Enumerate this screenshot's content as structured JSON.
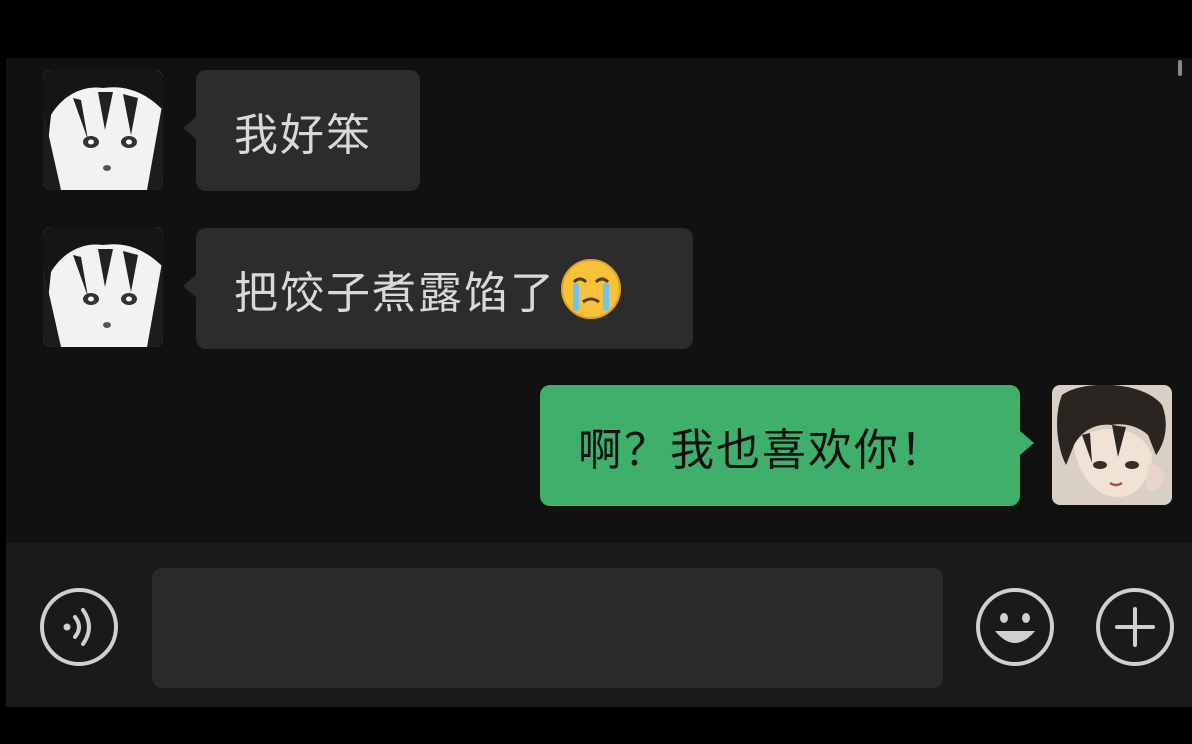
{
  "messages": [
    {
      "sender": "other",
      "text": "我好笨",
      "avatar": "anime-girl-avatar"
    },
    {
      "sender": "other",
      "text": "把饺子煮露馅了",
      "emoji": "crying-face-emoji",
      "avatar": "anime-girl-avatar"
    },
    {
      "sender": "self",
      "text": "啊？我也喜欢你！",
      "avatar": "anime-boy-avatar"
    }
  ],
  "input": {
    "value": "",
    "placeholder": ""
  },
  "icons": {
    "voice": "voice-icon",
    "emoji": "emoji-icon",
    "add": "plus-icon"
  },
  "colors": {
    "background": "#111111",
    "incoming_bubble": "#2c2c2c",
    "outgoing_bubble": "#3fb06b",
    "input_bar": "#1a1a1a"
  }
}
